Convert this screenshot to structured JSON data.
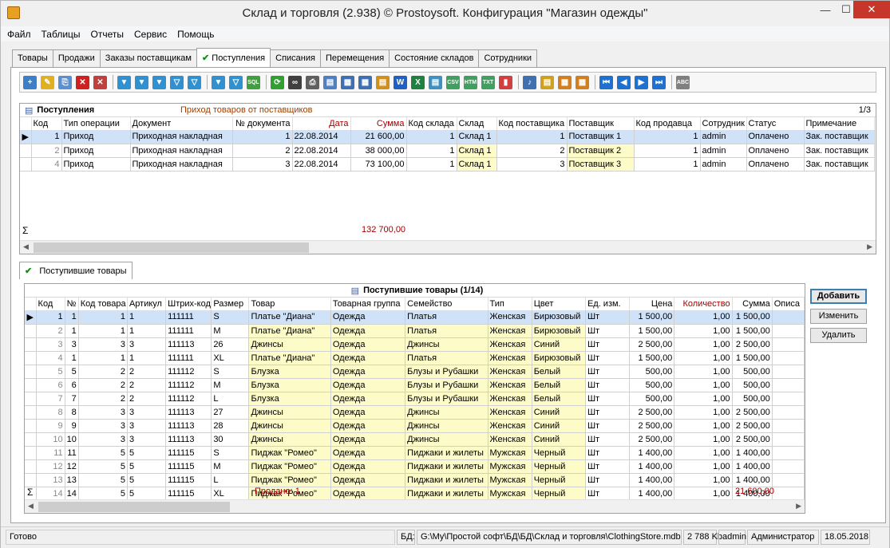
{
  "window": {
    "title": "Склад и торговля (2.938) © Prostoysoft. Конфигурация \"Магазин одежды\""
  },
  "menu": [
    "Файл",
    "Таблицы",
    "Отчеты",
    "Сервис",
    "Помощь"
  ],
  "tabs": [
    "Товары",
    "Продажи",
    "Заказы поставщикам",
    "Поступления",
    "Списания",
    "Перемещения",
    "Состояние складов",
    "Сотрудники"
  ],
  "active_tab": "Поступления",
  "top_grid": {
    "title": "Поступления",
    "subtitle": "Приход товаров от поставщиков",
    "page": "1/3",
    "columns": [
      "Код",
      "Тип операции",
      "Документ",
      "№ документа",
      "Дата",
      "Сумма",
      "Код склада",
      "Склад",
      "Код поставщика",
      "Поставщик",
      "Код продавца",
      "Сотрудник",
      "Статус",
      "Примечание"
    ],
    "rows": [
      [
        "1",
        "Приход",
        "Приходная накладная",
        "1",
        "22.08.2014",
        "21 600,00",
        "1",
        "Склад 1",
        "1",
        "Поставщик 1",
        "1",
        "admin",
        "Оплачено",
        "Зак. поставщик"
      ],
      [
        "2",
        "Приход",
        "Приходная накладная",
        "2",
        "22.08.2014",
        "38 000,00",
        "1",
        "Склад 1",
        "2",
        "Поставщик 2",
        "1",
        "admin",
        "Оплачено",
        "Зак. поставщик"
      ],
      [
        "4",
        "Приход",
        "Приходная накладная",
        "3",
        "22.08.2014",
        "73 100,00",
        "1",
        "Склад 1",
        "3",
        "Поставщик 3",
        "1",
        "admin",
        "Оплачено",
        "Зак. поставщик"
      ]
    ],
    "sum_symbol": "Σ",
    "total": "132 700,00"
  },
  "subtab": "Поступившие товары",
  "bottom_grid": {
    "title": "Поступившие товары (1/14)",
    "columns": [
      "Код",
      "№",
      "Код товара",
      "Артикул",
      "Штрих-код",
      "Размер",
      "Товар",
      "Товарная группа",
      "Семейство",
      "Тип",
      "Цвет",
      "Ед. изм.",
      "Цена",
      "Количество",
      "Сумма",
      "Описа"
    ],
    "rows": [
      [
        "1",
        "1",
        "1",
        "1",
        "111111",
        "S",
        "Платье \"Диана\"",
        "Одежда",
        "Платья",
        "Женская",
        "Бирюзовый",
        "Шт",
        "1 500,00",
        "1,00",
        "1 500,00"
      ],
      [
        "2",
        "1",
        "1",
        "1",
        "111111",
        "M",
        "Платье \"Диана\"",
        "Одежда",
        "Платья",
        "Женская",
        "Бирюзовый",
        "Шт",
        "1 500,00",
        "1,00",
        "1 500,00"
      ],
      [
        "3",
        "3",
        "3",
        "3",
        "111113",
        "26",
        "Джинсы",
        "Одежда",
        "Джинсы",
        "Женская",
        "Синий",
        "Шт",
        "2 500,00",
        "1,00",
        "2 500,00"
      ],
      [
        "4",
        "1",
        "1",
        "1",
        "111111",
        "XL",
        "Платье \"Диана\"",
        "Одежда",
        "Платья",
        "Женская",
        "Бирюзовый",
        "Шт",
        "1 500,00",
        "1,00",
        "1 500,00"
      ],
      [
        "5",
        "5",
        "2",
        "2",
        "111112",
        "S",
        "Блузка",
        "Одежда",
        "Блузы и Рубашки",
        "Женская",
        "Белый",
        "Шт",
        "500,00",
        "1,00",
        "500,00"
      ],
      [
        "6",
        "6",
        "2",
        "2",
        "111112",
        "M",
        "Блузка",
        "Одежда",
        "Блузы и Рубашки",
        "Женская",
        "Белый",
        "Шт",
        "500,00",
        "1,00",
        "500,00"
      ],
      [
        "7",
        "7",
        "2",
        "2",
        "111112",
        "L",
        "Блузка",
        "Одежда",
        "Блузы и Рубашки",
        "Женская",
        "Белый",
        "Шт",
        "500,00",
        "1,00",
        "500,00"
      ],
      [
        "8",
        "8",
        "3",
        "3",
        "111113",
        "27",
        "Джинсы",
        "Одежда",
        "Джинсы",
        "Женская",
        "Синий",
        "Шт",
        "2 500,00",
        "1,00",
        "2 500,00"
      ],
      [
        "9",
        "9",
        "3",
        "3",
        "111113",
        "28",
        "Джинсы",
        "Одежда",
        "Джинсы",
        "Женская",
        "Синий",
        "Шт",
        "2 500,00",
        "1,00",
        "2 500,00"
      ],
      [
        "10",
        "10",
        "3",
        "3",
        "111113",
        "30",
        "Джинсы",
        "Одежда",
        "Джинсы",
        "Женская",
        "Синий",
        "Шт",
        "2 500,00",
        "1,00",
        "2 500,00"
      ],
      [
        "11",
        "11",
        "5",
        "5",
        "111115",
        "S",
        "Пиджак \"Ромео\"",
        "Одежда",
        "Пиджаки и жилеты",
        "Мужская",
        "Черный",
        "Шт",
        "1 400,00",
        "1,00",
        "1 400,00"
      ],
      [
        "12",
        "12",
        "5",
        "5",
        "111115",
        "M",
        "Пиджак \"Ромео\"",
        "Одежда",
        "Пиджаки и жилеты",
        "Мужская",
        "Черный",
        "Шт",
        "1 400,00",
        "1,00",
        "1 400,00"
      ],
      [
        "13",
        "13",
        "5",
        "5",
        "111115",
        "L",
        "Пиджак \"Ромео\"",
        "Одежда",
        "Пиджаки и жилеты",
        "Мужская",
        "Черный",
        "Шт",
        "1 400,00",
        "1,00",
        "1 400,00"
      ],
      [
        "14",
        "14",
        "5",
        "5",
        "111115",
        "XL",
        "Пиджак \"Ромео\"",
        "Одежда",
        "Пиджаки и жилеты",
        "Мужская",
        "Черный",
        "Шт",
        "1 400,00",
        "1,00",
        "1 400,00"
      ]
    ],
    "sold": "Продано: 1",
    "total": "21 600,00"
  },
  "buttons": {
    "add": "Добавить",
    "edit": "Изменить",
    "delete": "Удалить"
  },
  "status": {
    "ready": "Готово",
    "db_label": "БД:",
    "db_path": "G:\\My\\Простой софт\\БД\\БД\\Склад и торговля\\ClothingStore.mdb",
    "size": "2 788 Kb",
    "user": "admin",
    "role": "Администратор",
    "date": "18.05.2018"
  },
  "colors": {
    "selected_row": "#cfe2f8",
    "highlight_cell": "#fdfbc8",
    "red_header": "#a00000",
    "brown_text": "#a04000"
  }
}
